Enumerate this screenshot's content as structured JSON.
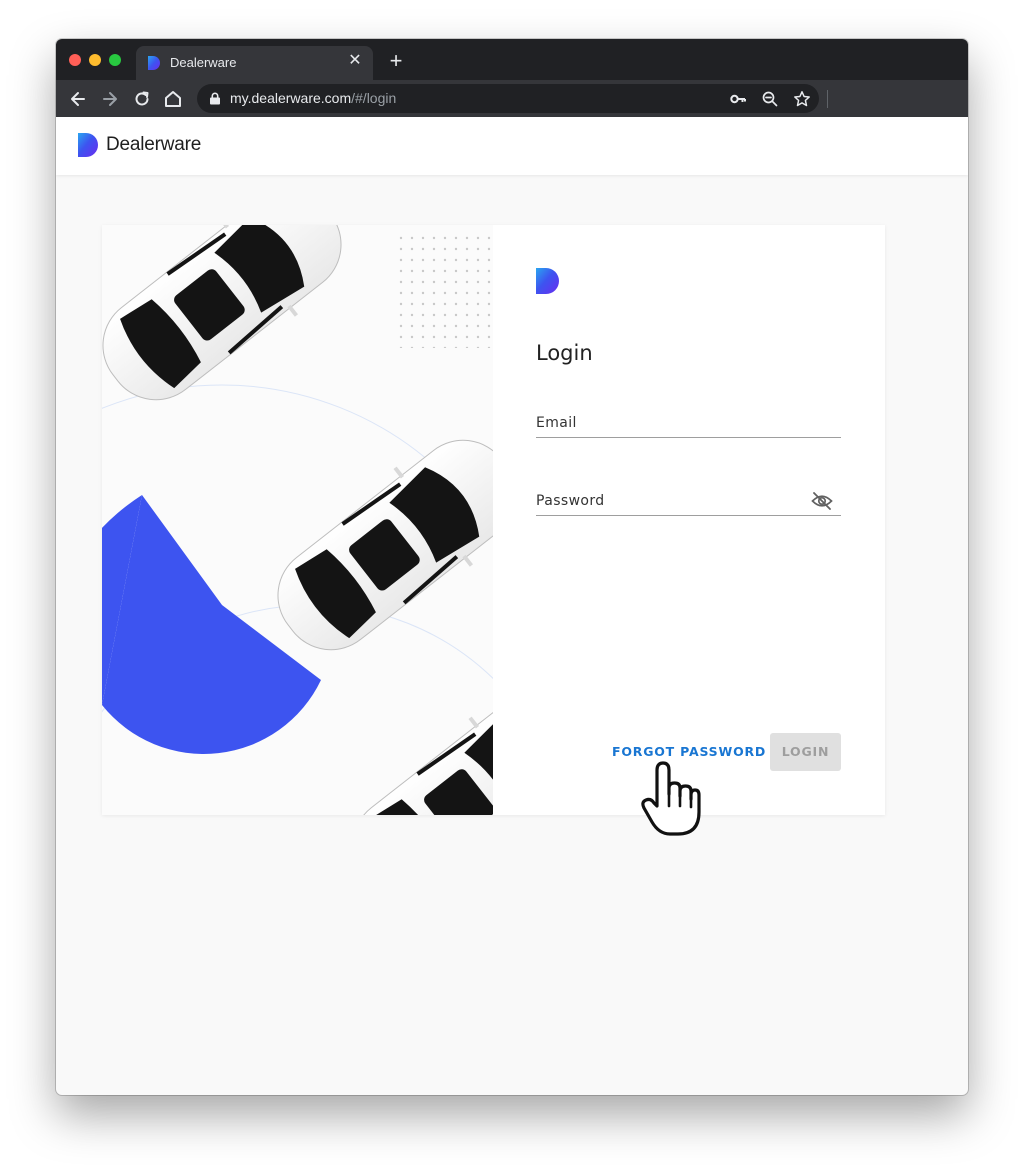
{
  "browser": {
    "tab": {
      "title": "Dealerware",
      "close_glyph": "✕"
    },
    "new_tab_glyph": "+",
    "url": {
      "host": "my.dealerware.com",
      "path": "/#/login"
    },
    "icons": [
      "back-icon",
      "forward-icon",
      "reload-icon",
      "home-icon",
      "lock-icon",
      "key-icon",
      "zoom-out-icon",
      "star-icon"
    ]
  },
  "header": {
    "brand_name": "Dealerware"
  },
  "login": {
    "title": "Login",
    "email_label": "Email",
    "password_label": "Password",
    "forgot_label": "FORGOT PASSWORD",
    "login_label": "LOGIN"
  },
  "colors": {
    "accent": "#3d54f0",
    "link": "#1976d2",
    "button_disabled_bg": "#e0e0e0",
    "button_disabled_text": "#9e9e9e",
    "page_bg": "#f9f9f9"
  }
}
